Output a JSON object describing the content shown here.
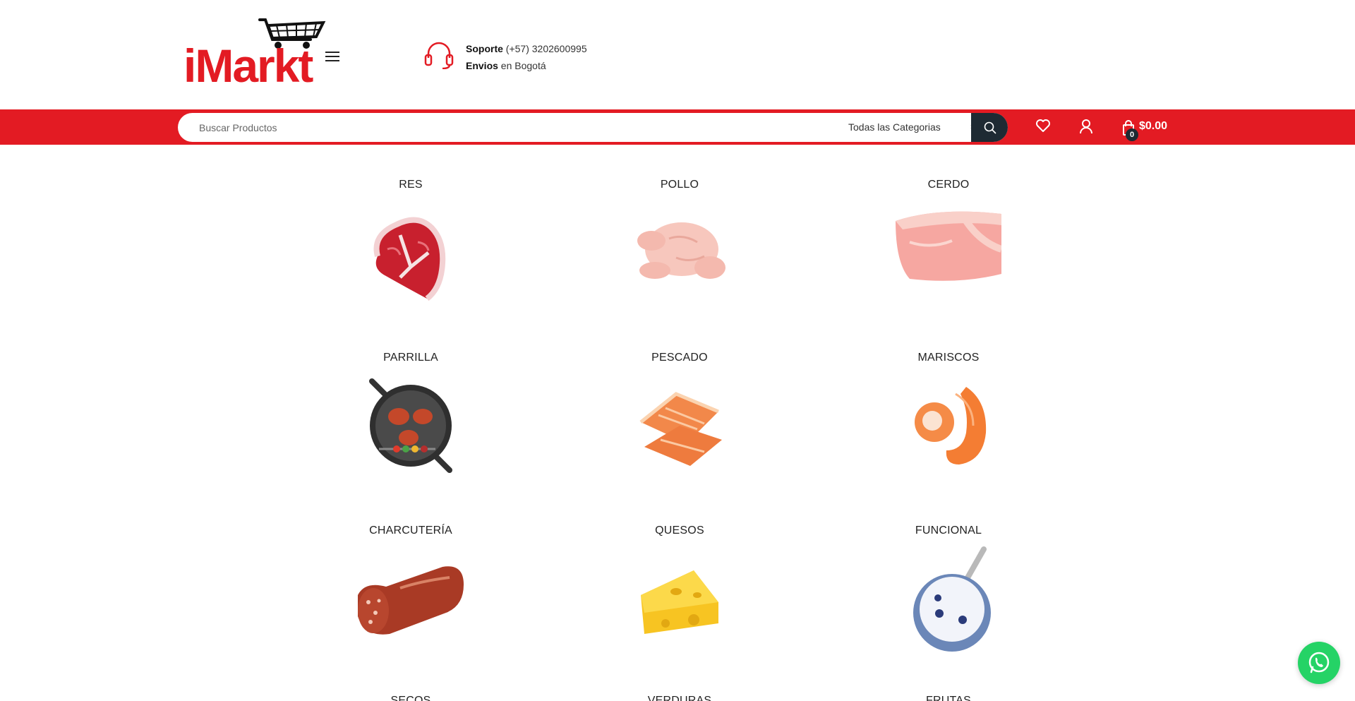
{
  "header": {
    "logo_text": "iMarkt",
    "support_label": "Soporte",
    "support_phone": "(+57) 3202600995",
    "shipping_label": "Envios",
    "shipping_text": "en Bogotá"
  },
  "search": {
    "placeholder": "Buscar Productos",
    "category_selected": "Todas las Categorias"
  },
  "cart": {
    "count": "0",
    "total": "$0.00"
  },
  "colors": {
    "brand_red": "#e31b23",
    "dark": "#1e2a33",
    "whatsapp": "#25d366"
  },
  "categories": [
    {
      "name": "RES",
      "icon": "beef-steak-icon"
    },
    {
      "name": "POLLO",
      "icon": "raw-chicken-icon"
    },
    {
      "name": "CERDO",
      "icon": "pork-meat-icon"
    },
    {
      "name": "PARRILLA",
      "icon": "grill-icon"
    },
    {
      "name": "PESCADO",
      "icon": "salmon-fillet-icon"
    },
    {
      "name": "MARISCOS",
      "icon": "shrimp-icon"
    },
    {
      "name": "CHARCUTERÍA",
      "icon": "sausage-icon"
    },
    {
      "name": "QUESOS",
      "icon": "cheese-icon"
    },
    {
      "name": "FUNCIONAL",
      "icon": "yogurt-bowl-icon"
    },
    {
      "name": "SECOS",
      "icon": ""
    },
    {
      "name": "VERDURAS",
      "icon": ""
    },
    {
      "name": "FRUTAS",
      "icon": ""
    }
  ]
}
